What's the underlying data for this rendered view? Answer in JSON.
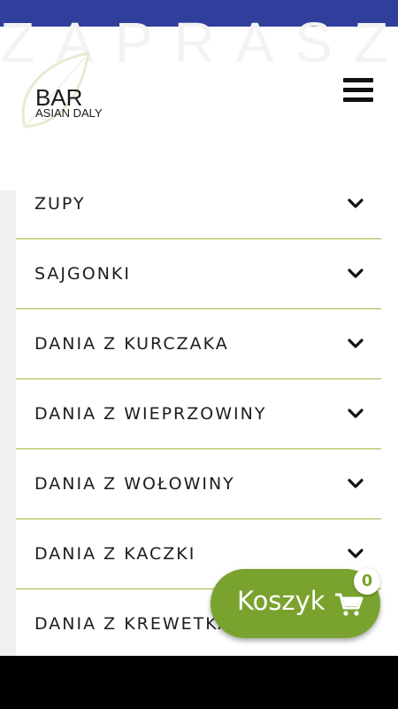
{
  "header": {
    "watermark": "ZAPRASZ",
    "logo_title": "BAR",
    "logo_subtitle": "ASIAN DALY"
  },
  "icons": {
    "menu": "hamburger-icon",
    "chevron": "chevron-down-icon",
    "cart": "shopping-cart-icon"
  },
  "menu": {
    "items": [
      {
        "label": "ZUPY"
      },
      {
        "label": "SAJGONKI"
      },
      {
        "label": "DANIA Z KURCZAKA"
      },
      {
        "label": "DANIA Z WIEPRZOWINY"
      },
      {
        "label": "DANIA Z WOŁOWINY"
      },
      {
        "label": "DANIA Z KACZKI"
      },
      {
        "label": "DANIA Z KREWETKAMI"
      }
    ]
  },
  "cart": {
    "label": "Koszyk",
    "count": "0"
  },
  "colors": {
    "status_bar": "#2f3f9b",
    "accent": "#7aa22e",
    "divider": "#9bbd3f"
  }
}
